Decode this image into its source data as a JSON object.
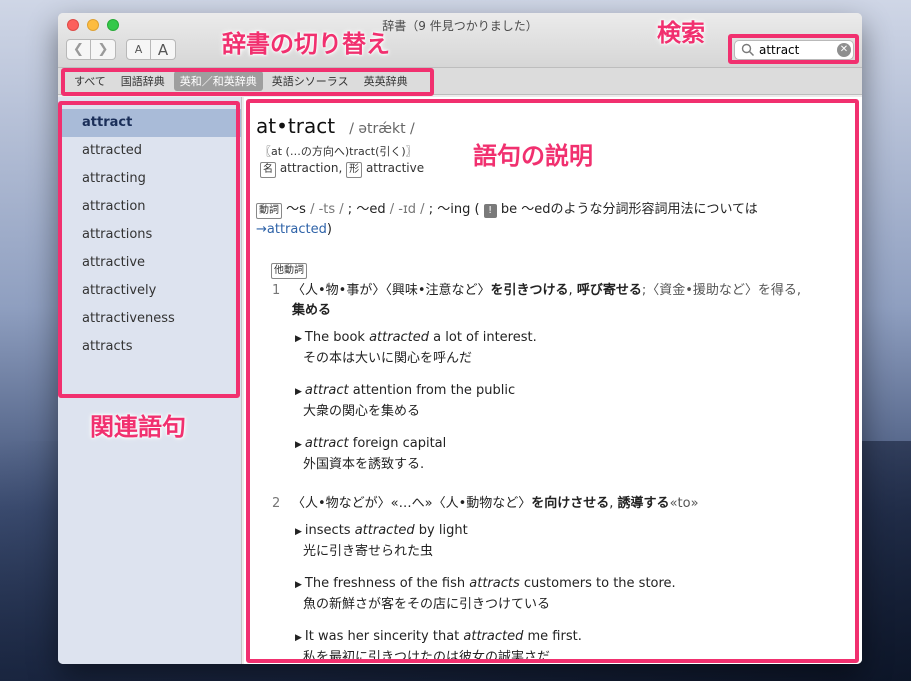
{
  "window": {
    "title": "辞書（9 件見つかりました）"
  },
  "toolbar": {
    "back_icon": "chevron-left-icon",
    "forward_icon": "chevron-right-icon",
    "font_small": "A",
    "font_large": "A"
  },
  "search": {
    "value": "attract",
    "clear_icon": "clear-icon"
  },
  "scopes": [
    "すべて",
    "国語辞典",
    "英和／和英辞典",
    "英語シソーラス",
    "英英辞典"
  ],
  "scope_selected": "英和／和英辞典",
  "sidebar": {
    "items": [
      "attract",
      "attracted",
      "attracting",
      "attraction",
      "attractions",
      "attractive",
      "attractively",
      "attractiveness",
      "attracts"
    ],
    "selected": "attract"
  },
  "entry": {
    "headword": "at•tract",
    "pronunciation": "/ ətrǽkt /",
    "etymology": "〖at (…の方向へ)tract(引く)〗",
    "derived_tag_noun": "名",
    "derived_noun": "attraction,",
    "derived_tag_adj": "形",
    "derived_adj": "attractive",
    "inflection_tag": "動詞",
    "inflection_1": "〜s",
    "inflection_1_pron": "/ -ts /",
    "inflection_sep1": ";",
    "inflection_2": "〜ed",
    "inflection_2_pron": "/ -ɪd /",
    "inflection_sep2": ";",
    "inflection_3": "〜ing (",
    "inflection_warn": "!",
    "inflection_note": "be 〜edのような分詞形容詞用法については",
    "inflection_link": "→attracted",
    "inflection_close": ")",
    "pos_tag": "他動詞",
    "senses": [
      {
        "num": "1",
        "prefix": "〈人•物•事が〉〈興味•注意など〉",
        "def_bold": "を引きつける",
        "def_mid": ",",
        "def_bold2": "呼び寄せる",
        "def_rest": ";〈資金•援助など〉を得る,",
        "def_line2": "集める",
        "examples": [
          {
            "en_pre": "The book ",
            "en_em": "attracted",
            "en_post": " a lot of interest.",
            "ja": "その本は大いに関心を呼んだ"
          },
          {
            "en_pre": "",
            "en_em": "attract",
            "en_post": " attention from the public",
            "ja": "大衆の関心を集める"
          },
          {
            "en_pre": "",
            "en_em": "attract",
            "en_post": " foreign capital",
            "ja": "外国資本を誘致する."
          }
        ]
      },
      {
        "num": "2",
        "prefix": "〈人•物などが〉«…へ»〈人•動物など〉",
        "def_bold": "を向けさせる",
        "def_mid": ",",
        "def_bold2": "誘導する",
        "def_rest": "«to»",
        "def_line2": "",
        "examples": [
          {
            "en_pre": "insects ",
            "en_em": "attracted",
            "en_post": " by light",
            "ja": "光に引き寄せられた虫"
          },
          {
            "en_pre": "The freshness of the fish ",
            "en_em": "attracts",
            "en_post": " customers to the store.",
            "ja": "魚の新鮮さが客をその店に引きつけている"
          },
          {
            "en_pre": "It was her sincerity that ",
            "en_em": "attracted",
            "en_post": " me first.",
            "ja": "私を最初に引きつけたのは彼女の誠実さだ."
          }
        ]
      }
    ]
  },
  "annotations": {
    "scope_label": "辞書の切り替え",
    "search_label": "検索",
    "content_label": "語句の説明",
    "sidebar_label": "関連語句",
    "color": "#f1306f"
  }
}
